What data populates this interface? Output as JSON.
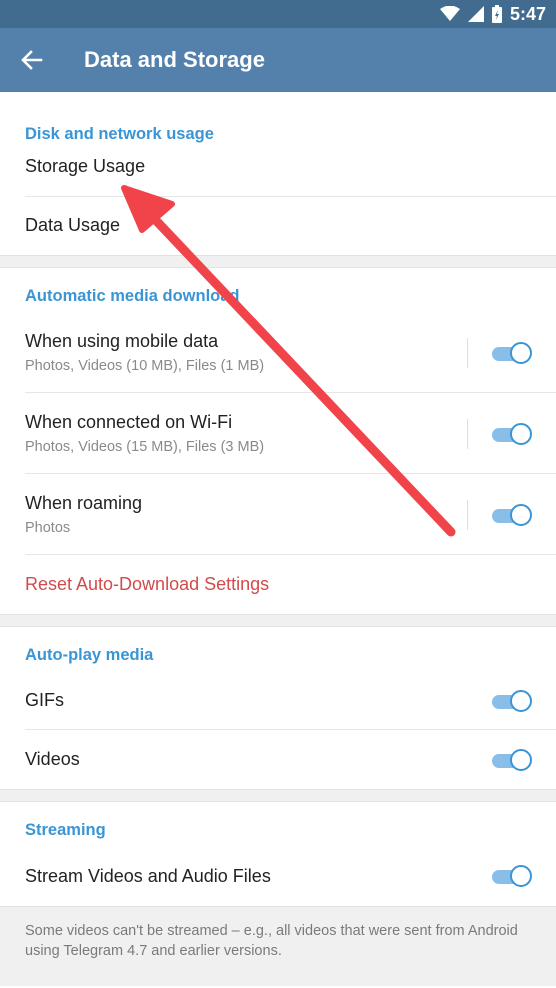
{
  "status_bar": {
    "time": "5:47",
    "icons": [
      "wifi-icon",
      "cell-signal-icon",
      "battery-icon"
    ]
  },
  "app_bar": {
    "back_icon": "arrow-left-icon",
    "title": "Data and Storage"
  },
  "sections": {
    "disk": {
      "header": "Disk and network usage",
      "items": [
        {
          "label": "Storage Usage"
        },
        {
          "label": "Data Usage"
        }
      ]
    },
    "auto_download": {
      "header": "Automatic media download",
      "items": [
        {
          "title": "When using mobile data",
          "subtitle": "Photos, Videos (10 MB), Files (1 MB)",
          "enabled": true
        },
        {
          "title": "When connected on Wi-Fi",
          "subtitle": "Photos, Videos (15 MB), Files (3 MB)",
          "enabled": true
        },
        {
          "title": "When roaming",
          "subtitle": "Photos",
          "enabled": true
        }
      ],
      "reset_label": "Reset Auto-Download Settings"
    },
    "autoplay": {
      "header": "Auto-play media",
      "items": [
        {
          "label": "GIFs",
          "enabled": true
        },
        {
          "label": "Videos",
          "enabled": true
        }
      ]
    },
    "streaming": {
      "header": "Streaming",
      "items": [
        {
          "label": "Stream Videos and Audio Files",
          "enabled": true
        }
      ],
      "note": "Some videos can't be streamed – e.g., all videos that were sent from Android using Telegram 4.7 and earlier versions."
    }
  },
  "colors": {
    "status_bar": "#426c8f",
    "app_bar": "#5381ab",
    "accent": "#3a95d5",
    "destructive": "#d44a4a",
    "annotation_arrow": "#f0434a"
  }
}
